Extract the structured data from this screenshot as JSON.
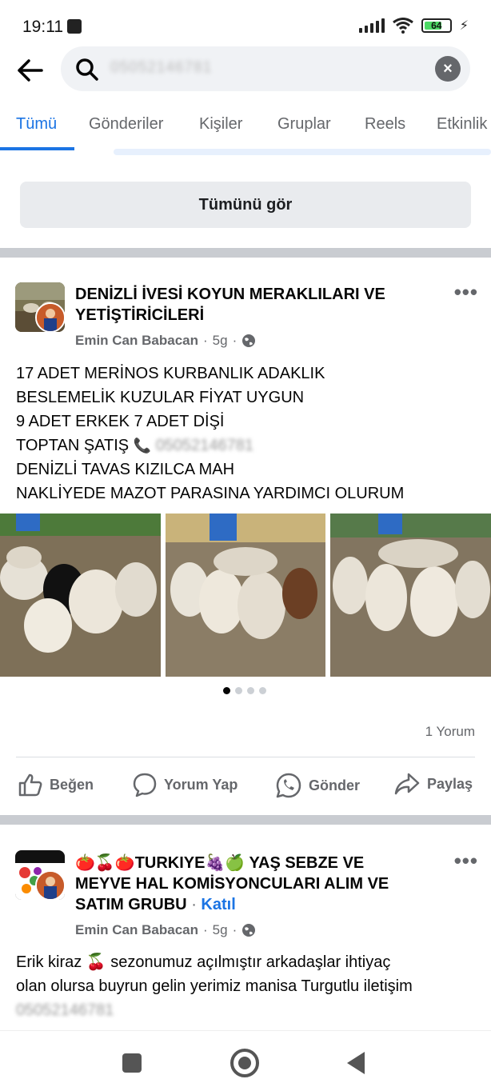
{
  "status_bar": {
    "time": "19:11",
    "battery_level": "64",
    "icons": [
      "notification-icon",
      "signal-icon",
      "wifi-icon",
      "battery-icon",
      "charging-icon"
    ]
  },
  "search": {
    "value": "05052146781",
    "clear_icon": "close-icon"
  },
  "tabs": [
    {
      "label": "Tümü",
      "active": true
    },
    {
      "label": "Gönderiler",
      "active": false
    },
    {
      "label": "Kişiler",
      "active": false
    },
    {
      "label": "Gruplar",
      "active": false
    },
    {
      "label": "Reels",
      "active": false
    },
    {
      "label": "Etkinlik",
      "active": false
    }
  ],
  "see_all_label": "Tümünü gör",
  "post1": {
    "group_line1": "DENİZLİ İVESİ KOYUN MERAKLILARI VE",
    "group_line2": "YETİŞTİRİCİLERİ",
    "author": "Emin Can Babacan",
    "time": "5g",
    "text_lines": [
      "17 ADET MERİNOS KURBANLIK ADAKLIK",
      "BESLEMELİK KUZULAR FİYAT UYGUN",
      "9 ADET ERKEK 7 ADET DİŞİ",
      "TOPTAN ŞATIŞ",
      "DENİZLİ TAVAS KIZILCA MAH",
      "NAKLİYEDE MAZOT PARASINA YARDIMCI OLURUM"
    ],
    "phone": "05052146781",
    "carousel_pages": 4,
    "carousel_active_page": 1,
    "comment_count": "1 Yorum",
    "actions": {
      "like": "Beğen",
      "comment": "Yorum Yap",
      "send": "Gönder",
      "share": "Paylaş"
    }
  },
  "post2": {
    "group_line1": "🍅🍒🍅TURKIYE🍇🍏 YAŞ SEBZE VE",
    "group_line2": "MEYVE HAL KOMİSYONCULARI ALIM VE",
    "group_line3": "SATIM GRUBU",
    "join_label": "Katıl",
    "author": "Emin Can Babacan",
    "time": "5g",
    "text_line1": "Erik kiraz 🍒 sezonumuz açılmıştır arkadaşlar ihtiyaç",
    "text_line2": "olan olursa buyrun gelin yerimiz manisa Turgutlu iletişim",
    "phone": "05052146781"
  }
}
